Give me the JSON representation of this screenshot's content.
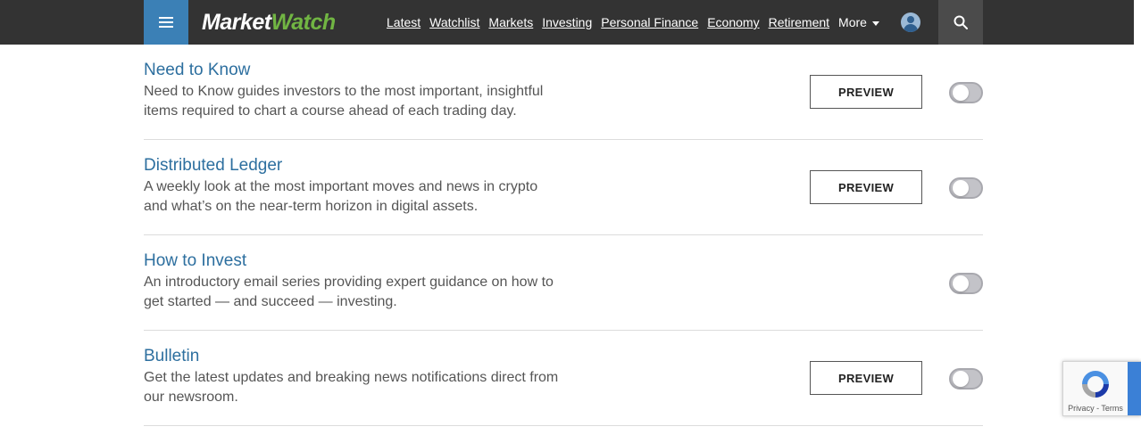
{
  "header": {
    "logo_part1": "Market",
    "logo_part2": "Watch",
    "nav": [
      "Latest",
      "Watchlist",
      "Markets",
      "Investing",
      "Personal Finance",
      "Economy",
      "Retirement"
    ],
    "more_label": "More",
    "icons": {
      "menu": "hamburger-icon",
      "user": "user-icon",
      "search": "search-icon"
    },
    "colors": {
      "bar": "#333333",
      "menu_accent": "#3b80b6",
      "logo_accent": "#71b543"
    }
  },
  "newsletters": [
    {
      "title": "Need to Know",
      "description": "Need to Know guides investors to the most important, insightful items required to chart a course ahead of each trading day.",
      "preview_label": "PREVIEW",
      "subscribed": false
    },
    {
      "title": "Distributed Ledger",
      "description": "A weekly look at the most important moves and news in crypto and what’s on the near-term horizon in digital assets.",
      "preview_label": "PREVIEW",
      "subscribed": false
    },
    {
      "title": "How to Invest",
      "description": "An introductory email series providing expert guidance on how to get started — and succeed — investing.",
      "preview_label": "",
      "subscribed": false
    },
    {
      "title": "Bulletin",
      "description": "Get the latest updates and breaking news notifications direct from our newsroom.",
      "preview_label": "PREVIEW",
      "subscribed": false
    }
  ],
  "recaptcha": {
    "privacy_label": "Privacy",
    "separator": " - ",
    "terms_label": "Terms"
  },
  "colors": {
    "title_link": "#2d6f9f",
    "toggle_off": "#c3c3c8"
  }
}
